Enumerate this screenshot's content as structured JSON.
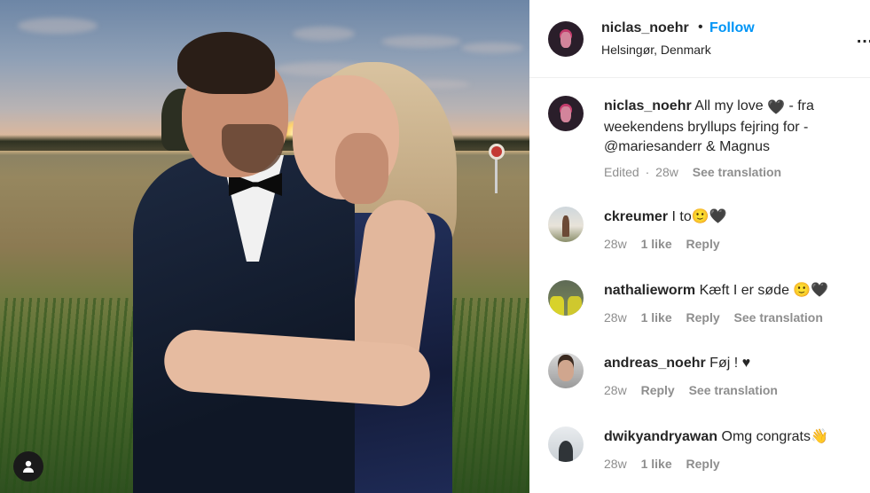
{
  "post": {
    "username": "niclas_noehr",
    "separator": "•",
    "follow_label": "Follow",
    "location": "Helsingør, Denmark",
    "more_label": "…"
  },
  "caption": {
    "username": "niclas_noehr",
    "text_1": "All my love",
    "heart": "🖤",
    "text_2": "- fra weekendens bryllups fejring for -",
    "mention": "@mariesanderr",
    "text_3": "& Magnus",
    "edited": "Edited",
    "meta_sep": "·",
    "time": "28w",
    "see_translation": "See translation"
  },
  "comments": [
    {
      "username": "ckreumer",
      "text": "I to🙂🖤",
      "time": "28w",
      "likes": "1 like",
      "reply": "Reply",
      "see_translation": ""
    },
    {
      "username": "nathalieworm",
      "text": "Kæft I er søde 🙂🖤",
      "time": "28w",
      "likes": "1 like",
      "reply": "Reply",
      "see_translation": "See translation"
    },
    {
      "username": "andreas_noehr",
      "text": "Føj ! ♥",
      "time": "28w",
      "likes": "",
      "reply": "Reply",
      "see_translation": "See translation"
    },
    {
      "username": "dwikyandryawan",
      "text": "Omg congrats👋",
      "time": "28w",
      "likes": "1 like",
      "reply": "Reply",
      "see_translation": ""
    }
  ],
  "icons": {
    "user_tag": "user-tag-icon",
    "more": "more-options-icon"
  },
  "colors": {
    "accent": "#0095f6",
    "muted": "#8e8e8e",
    "text": "#262626"
  }
}
